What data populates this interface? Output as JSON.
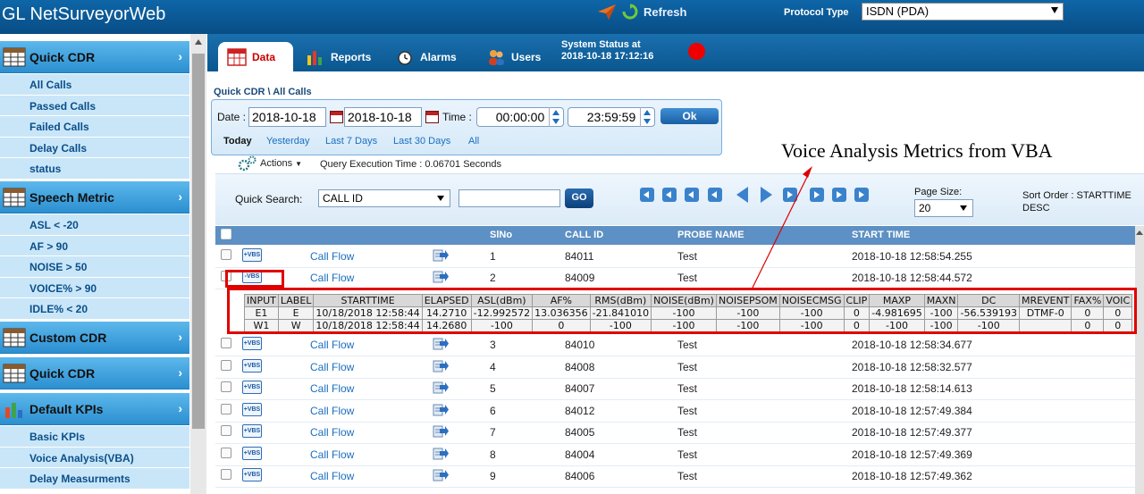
{
  "app": {
    "title": "GL NetSurveyorWeb",
    "refresh_label": "Refresh",
    "protocol_label": "Protocol Type",
    "protocol_value": "ISDN (PDA)"
  },
  "sidebar": {
    "sections": [
      {
        "label": "Quick CDR",
        "items": [
          "All Calls",
          "Passed Calls",
          "Failed Calls",
          "Delay Calls",
          "status"
        ]
      },
      {
        "label": "Speech Metric",
        "items": [
          "ASL < -20",
          "AF > 90",
          "NOISE > 50",
          "VOICE% > 90",
          "IDLE% < 20"
        ]
      },
      {
        "label": "Custom CDR",
        "items": []
      },
      {
        "label": "Quick CDR",
        "items": []
      },
      {
        "label": "Default KPIs",
        "items": [
          "Basic KPIs",
          "Voice Analysis(VBA)",
          "Delay Measurments"
        ]
      }
    ]
  },
  "tabs": {
    "data": "Data",
    "reports": "Reports",
    "alarms": "Alarms",
    "users": "Users"
  },
  "system_status": {
    "label": "System Status at",
    "time": "2018-10-18 17:12:16",
    "color": "#ee0000"
  },
  "breadcrumb": "Quick CDR \\ All Calls",
  "filter": {
    "date_label": "Date :",
    "date_from": "2018-10-18",
    "date_to": "2018-10-18",
    "time_label": "Time :",
    "time_from": "00:00:00",
    "time_to": "23:59:59",
    "ok_label": "Ok",
    "quick_ranges": [
      "Today",
      "Yesterday",
      "Last 7 Days",
      "Last 30 Days",
      "All"
    ]
  },
  "actions_label": "Actions",
  "query_time": "Query Execution Time : 0.06701 Seconds",
  "annotation": "Voice Analysis Metrics  from VBA",
  "search": {
    "label": "Quick Search:",
    "field": "CALL ID",
    "value": "",
    "go_label": "GO",
    "page_size_label": "Page Size:",
    "page_size": "20",
    "sort_order_line1": "Sort Order : STARTTIME",
    "sort_order_line2": "DESC"
  },
  "table": {
    "columns": [
      "SlNo",
      "CALL ID",
      "PROBE NAME",
      "START TIME"
    ],
    "link_label": "Call Flow",
    "rows": [
      {
        "slno": "1",
        "call_id": "84011",
        "probe": "Test",
        "start": "2018-10-18 12:58:54.255",
        "vbs": "+VBS"
      },
      {
        "slno": "2",
        "call_id": "84009",
        "probe": "Test",
        "start": "2018-10-18 12:58:44.572",
        "vbs": "-VBS"
      },
      {
        "slno": "3",
        "call_id": "84010",
        "probe": "Test",
        "start": "2018-10-18 12:58:34.677",
        "vbs": "+VBS"
      },
      {
        "slno": "4",
        "call_id": "84008",
        "probe": "Test",
        "start": "2018-10-18 12:58:32.577",
        "vbs": "+VBS"
      },
      {
        "slno": "5",
        "call_id": "84007",
        "probe": "Test",
        "start": "2018-10-18 12:58:14.613",
        "vbs": "+VBS"
      },
      {
        "slno": "6",
        "call_id": "84012",
        "probe": "Test",
        "start": "2018-10-18 12:57:49.384",
        "vbs": "+VBS"
      },
      {
        "slno": "7",
        "call_id": "84005",
        "probe": "Test",
        "start": "2018-10-18 12:57:49.377",
        "vbs": "+VBS"
      },
      {
        "slno": "8",
        "call_id": "84004",
        "probe": "Test",
        "start": "2018-10-18 12:57:49.369",
        "vbs": "+VBS"
      },
      {
        "slno": "9",
        "call_id": "84006",
        "probe": "Test",
        "start": "2018-10-18 12:57:49.362",
        "vbs": "+VBS"
      }
    ]
  },
  "vba": {
    "headers": [
      "INPUT",
      "LABEL",
      "STARTTIME",
      "ELAPSED",
      "ASL(dBm)",
      "AF%",
      "RMS(dBm)",
      "NOISE(dBm)",
      "NOISEPSOM",
      "NOISECMSG",
      "CLIP",
      "MAXP",
      "MAXN",
      "DC",
      "MREVENT",
      "FAX%",
      "VOIC"
    ],
    "rows": [
      [
        "E1",
        "E",
        "10/18/2018 12:58:44",
        "14.2710",
        "-12.992572",
        "13.036356",
        "-21.841010",
        "-100",
        "-100",
        "-100",
        "0",
        "-4.981695",
        "-100",
        "-56.539193",
        "DTMF-0",
        "0",
        "0"
      ],
      [
        "W1",
        "W",
        "10/18/2018 12:58:44",
        "14.2680",
        "-100",
        "0",
        "-100",
        "-100",
        "-100",
        "-100",
        "0",
        "-100",
        "-100",
        "-100",
        "",
        "0",
        "0"
      ]
    ]
  }
}
